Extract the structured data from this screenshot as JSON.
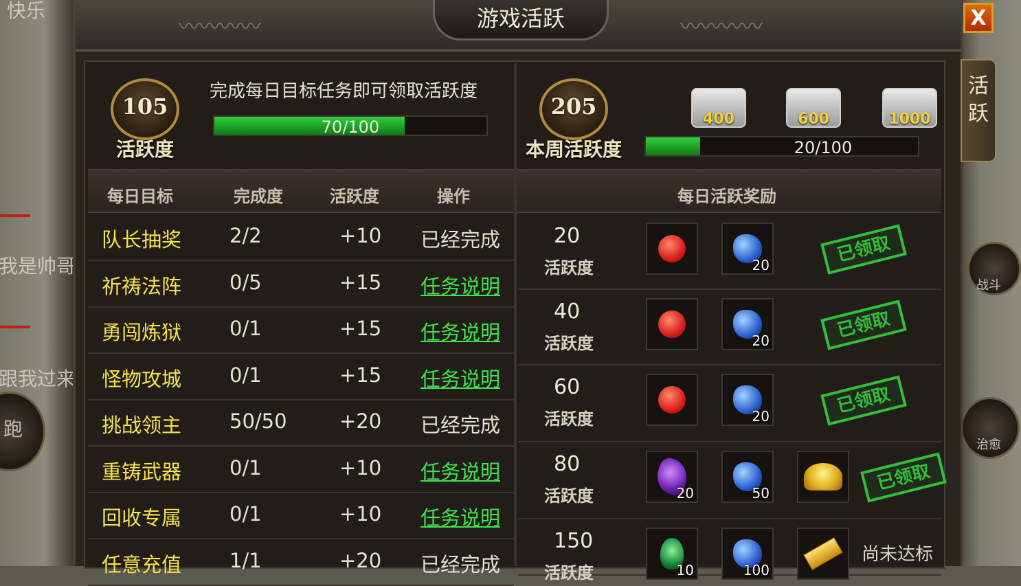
{
  "window": {
    "title": "游戏活跃",
    "close_label": "X",
    "side_tab": "活跃"
  },
  "background": {
    "left_texts": [
      "快乐",
      "我是帅哥",
      "跟我过来",
      "跑"
    ],
    "right_buttons": [
      "战斗",
      "治愈"
    ]
  },
  "daily": {
    "score": "105",
    "score_label": "活跃度",
    "description": "完成每日目标任务即可领取活跃度",
    "progress_text": "70/100",
    "progress_fraction": 0.7
  },
  "weekly": {
    "score": "205",
    "score_label": "本周活跃度",
    "progress_text": "20/100",
    "progress_fraction": 0.2,
    "chests": [
      "400",
      "600",
      "1000"
    ]
  },
  "tasks_header": {
    "name": "每日目标",
    "progress": "完成度",
    "activity": "活跃度",
    "action": "操作"
  },
  "tasks": [
    {
      "name": "队长抽奖",
      "progress": "2/2",
      "activity": "+10",
      "action": "已经完成",
      "is_link": false
    },
    {
      "name": "祈祷法阵",
      "progress": "0/5",
      "activity": "+15",
      "action": "任务说明",
      "is_link": true
    },
    {
      "name": "勇闯炼狱",
      "progress": "0/1",
      "activity": "+15",
      "action": "任务说明",
      "is_link": true
    },
    {
      "name": "怪物攻城",
      "progress": "0/1",
      "activity": "+15",
      "action": "任务说明",
      "is_link": true
    },
    {
      "name": "挑战领主",
      "progress": "50/50",
      "activity": "+20",
      "action": "已经完成",
      "is_link": false
    },
    {
      "name": "重铸武器",
      "progress": "0/1",
      "activity": "+10",
      "action": "任务说明",
      "is_link": true
    },
    {
      "name": "回收专属",
      "progress": "0/1",
      "activity": "+10",
      "action": "任务说明",
      "is_link": true
    },
    {
      "name": "任意充值",
      "progress": "1/1",
      "activity": "+20",
      "action": "已经完成",
      "is_link": false
    }
  ],
  "rewards_header": "每日活跃奖励",
  "rewards_unit": "活跃度",
  "rewards": [
    {
      "value": "20",
      "items": [
        {
          "icon": "apple-icon",
          "count": ""
        },
        {
          "icon": "blue-gem-icon",
          "count": "20"
        }
      ],
      "status": "已领取",
      "claimed": true
    },
    {
      "value": "40",
      "items": [
        {
          "icon": "apple-icon",
          "count": ""
        },
        {
          "icon": "blue-gem-icon",
          "count": "20"
        }
      ],
      "status": "已领取",
      "claimed": true
    },
    {
      "value": "60",
      "items": [
        {
          "icon": "apple-icon",
          "count": ""
        },
        {
          "icon": "blue-gem-icon",
          "count": "20"
        }
      ],
      "status": "已领取",
      "claimed": true
    },
    {
      "value": "80",
      "items": [
        {
          "icon": "purple-crystal-icon",
          "count": "20"
        },
        {
          "icon": "blue-gem-icon",
          "count": "50"
        },
        {
          "icon": "gold-coins-icon",
          "count": ""
        }
      ],
      "status": "已领取",
      "claimed": true
    },
    {
      "value": "150",
      "items": [
        {
          "icon": "green-amulet-icon",
          "count": "10"
        },
        {
          "icon": "blue-gem-icon",
          "count": "100"
        },
        {
          "icon": "gold-bar-icon",
          "count": ""
        }
      ],
      "status": "尚未达标",
      "claimed": false
    }
  ],
  "colors": {
    "task_name": "#f2e44a",
    "link": "#3ee24a",
    "stamp": "#2fbf3a",
    "progress_fill": "#2fcf3a"
  }
}
